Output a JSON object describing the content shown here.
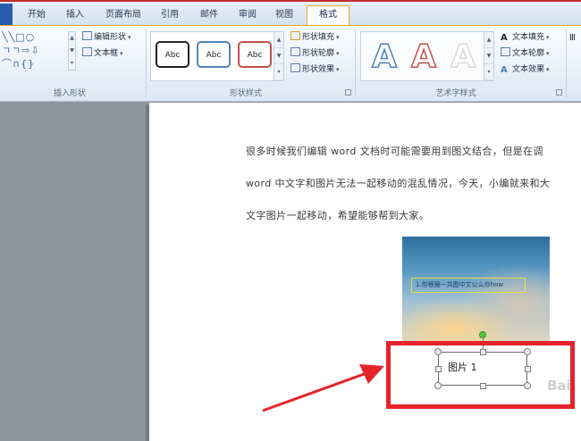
{
  "tabs": [
    {
      "label": "开始"
    },
    {
      "label": "插入"
    },
    {
      "label": "页面布局"
    },
    {
      "label": "引用"
    },
    {
      "label": "邮件"
    },
    {
      "label": "审阅"
    },
    {
      "label": "视图"
    },
    {
      "label": "格式",
      "active": true
    }
  ],
  "ribbon": {
    "insert_shapes": {
      "edit_shape": "编辑形状",
      "text_box": "文本框",
      "label": "插入形状"
    },
    "shape_styles": {
      "samples": [
        "Abc",
        "Abc",
        "Abc"
      ],
      "sample_colors": [
        "#222222",
        "#4f81bd",
        "#c0504d"
      ],
      "fill": "形状填充",
      "outline": "形状轮廓",
      "effects": "形状效果",
      "label": "形状样式"
    },
    "wordart_styles": {
      "samples": [
        "A",
        "A",
        "A"
      ],
      "sample_colors": [
        "#4f81bd",
        "#c0504d",
        "#d8d8d8"
      ],
      "text_fill": "文本填充",
      "text_outline": "文本轮廓",
      "text_effects": "文本效果",
      "label": "艺术字样式"
    }
  },
  "document": {
    "paragraphs": [
      "很多时候我们编辑 word 文档时可能需要用到图文结合，但是在调",
      "word 中文字和图片无法一起移动的混乱情况，今天，小编就来和大",
      "文字图片一起移动，希望能够帮到大家。"
    ],
    "picture_caption": "1.你根据一共图中文公么你how",
    "textbox_text": "图片 1"
  },
  "watermark": "Bai"
}
